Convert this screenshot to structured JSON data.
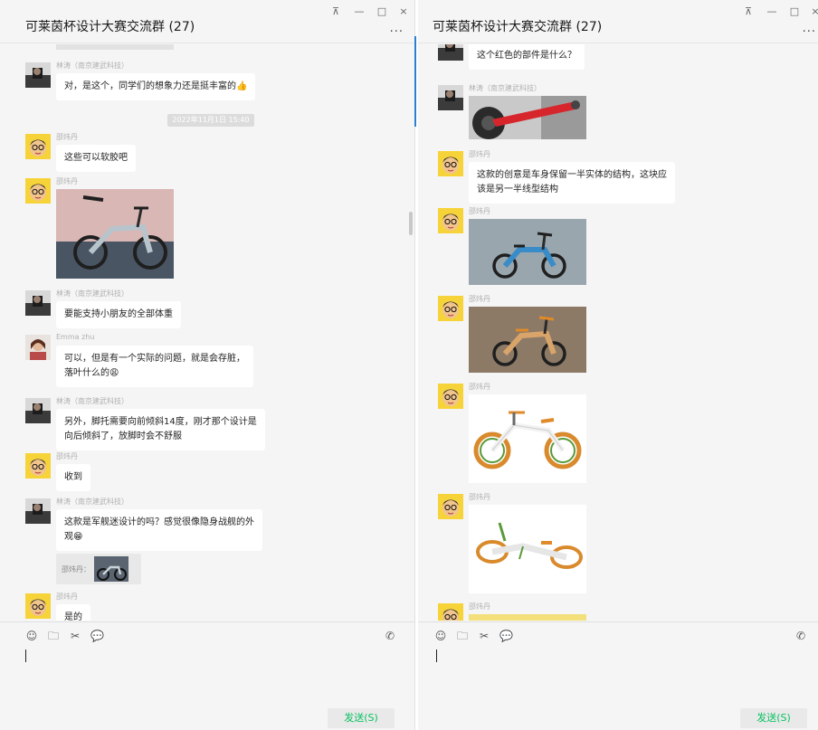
{
  "left": {
    "title": "可莱茵杯设计大赛交流群 (27)",
    "win_controls": [
      "⊼",
      "—",
      "□",
      "×"
    ],
    "more": "...",
    "timestamp": "2022年11月1日 15:40",
    "messages": [
      {
        "sender": "林涛（南京建武科技）",
        "text": "对，是这个，同学们的想象力还是挺丰富的👍"
      },
      {
        "sender": "邵炜丹",
        "text": "这些可以软胶吧"
      },
      {
        "sender": "邵炜丹"
      },
      {
        "sender": "林涛（南京建武科技）",
        "text": "要能支持小朋友的全部体重"
      },
      {
        "sender": "Emma zhu",
        "lines": [
          "可以，但是有一个实际的问题，就是会存脏，",
          "落叶什么的😩"
        ]
      },
      {
        "sender": "林涛（南京建武科技）",
        "lines": [
          "另外，脚托需要向前倾斜14度，刚才那个设计是",
          "向后倾斜了，放脚时会不舒服"
        ]
      },
      {
        "sender": "邵炜丹",
        "text": "收到"
      },
      {
        "sender": "林涛（南京建武科技）",
        "lines": [
          "这款是军舰迷设计的吗？感觉很像隐身战舰的外",
          "观😁"
        ],
        "quote": "邵炜丹："
      },
      {
        "sender": "邵炜丹",
        "text": "是的"
      }
    ],
    "send_label": "发送(S)"
  },
  "right": {
    "title": "可莱茵杯设计大赛交流群 (27)",
    "win_controls": [
      "⊼",
      "—",
      "□",
      "×"
    ],
    "more": "...",
    "messages": [
      {
        "text": "这个红色的部件是什么？"
      },
      {
        "sender": "林涛（南京建武科技）"
      },
      {
        "sender": "邵炜丹",
        "lines": [
          "这款的创意是车身保留一半实体的结构，这块应",
          "该是另一半线型结构"
        ]
      },
      {
        "sender": "邵炜丹"
      },
      {
        "sender": "邵炜丹"
      },
      {
        "sender": "邵炜丹"
      },
      {
        "sender": "邵炜丹"
      },
      {
        "sender": "邵炜丹"
      }
    ],
    "send_label": "发送(S)"
  },
  "icons": {
    "emoji": "☺",
    "folder": "🗀",
    "scissors": "✂",
    "chat": "💬",
    "call": "✆"
  },
  "colors": {
    "send_text": "#07c160",
    "window_bg": "#f5f5f5"
  }
}
